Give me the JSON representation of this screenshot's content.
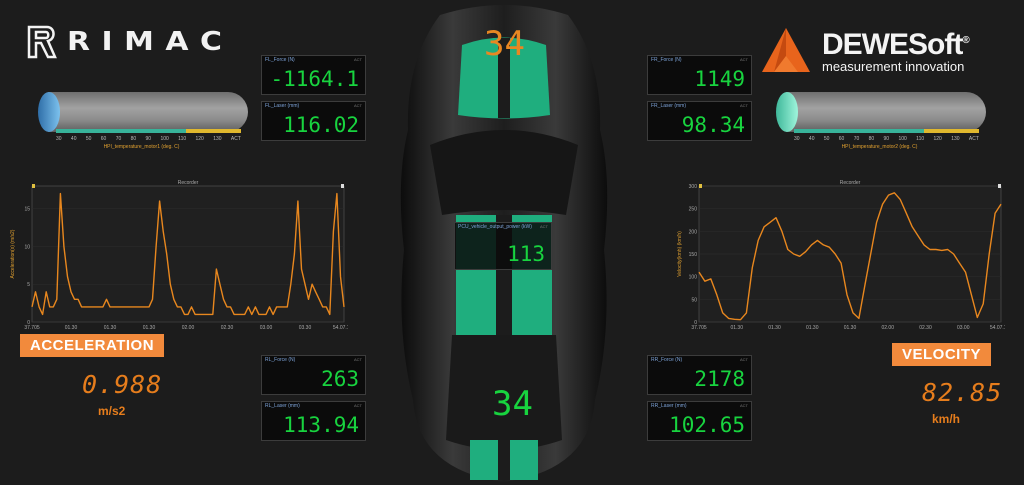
{
  "logos": {
    "rimac": "RIMAC",
    "dewesoft_name": "DEWESoft",
    "dewesoft_reg": "®",
    "dewesoft_tagline": "measurement innovation"
  },
  "gauges": {
    "left": {
      "label": "HPI_temperature_motor1 (deg. C)",
      "ticks": [
        "30",
        "40",
        "50",
        "60",
        "70",
        "80",
        "90",
        "100",
        "110",
        "120",
        "130"
      ],
      "act": "ACT",
      "fill_color": "#4aa8d8"
    },
    "right": {
      "label": "HPI_temperature_motor2 (deg. C)",
      "ticks": [
        "30",
        "40",
        "50",
        "60",
        "70",
        "80",
        "90",
        "100",
        "110",
        "120",
        "130"
      ],
      "act": "ACT",
      "fill_color": "#6fe3c2"
    }
  },
  "panels": {
    "fl_force": {
      "label": "FL_Force (N)",
      "act": "ACT",
      "value": "-1164.1"
    },
    "fl_laser": {
      "label": "FL_Laser (mm)",
      "act": "ACT",
      "value": "116.02"
    },
    "fr_force": {
      "label": "FR_Force (N)",
      "act": "ACT",
      "value": "1149"
    },
    "fr_laser": {
      "label": "FR_Laser (mm)",
      "act": "ACT",
      "value": "98.34"
    },
    "rl_force": {
      "label": "RL_Force (N)",
      "act": "ACT",
      "value": "263"
    },
    "rl_laser": {
      "label": "RL_Laser (mm)",
      "act": "ACT",
      "value": "113.94"
    },
    "rr_force": {
      "label": "RR_Force (N)",
      "act": "ACT",
      "value": "2178"
    },
    "rr_laser": {
      "label": "RR_Laser (mm)",
      "act": "ACT",
      "value": "102.65"
    },
    "pcu_power": {
      "label": "PCU_vehicle_output_power (kW)",
      "act": "ACT",
      "value": "113"
    }
  },
  "car": {
    "number_top": "34",
    "number_bottom": "34"
  },
  "acceleration": {
    "badge": "ACCELERATION",
    "value": "0.988",
    "unit": "m/s2"
  },
  "velocity": {
    "badge": "VELOCITY",
    "value": "82.85",
    "unit": "km/h"
  },
  "chart_data": [
    {
      "type": "line",
      "title": "Recorder",
      "ylabel": "Acceleration(x) (m/s2)",
      "x_ticks": [
        "37.705",
        "01.30",
        "01.30",
        "01.30",
        "02.00",
        "02.30",
        "03.00",
        "03.30",
        "54.07.181"
      ],
      "y_ticks": [
        "0",
        "5",
        "10",
        "15"
      ],
      "ylim": [
        0,
        18
      ],
      "color": "#e8871e",
      "values": [
        2,
        4,
        2,
        1,
        4,
        2,
        2,
        3,
        17,
        10,
        6,
        4,
        3,
        3,
        2,
        2,
        2,
        2,
        2,
        2,
        2,
        3,
        2,
        2,
        2,
        2,
        2,
        2,
        2,
        2,
        2,
        2,
        2,
        2,
        3,
        10,
        16,
        12,
        9,
        5,
        3,
        2,
        2,
        1,
        1,
        2,
        1,
        1,
        1,
        1,
        1,
        1,
        7,
        5,
        3,
        2,
        2,
        1,
        1,
        1,
        1,
        2,
        1,
        2,
        1,
        1,
        1,
        2,
        1,
        2,
        2,
        2,
        2,
        5,
        9,
        16,
        7,
        5,
        3,
        5,
        4,
        3,
        2,
        2,
        1,
        12,
        17,
        6,
        2
      ]
    },
    {
      "type": "line",
      "title": "Recorder",
      "ylabel": "Velocity(kmh) (km/h)",
      "x_ticks": [
        "37.705",
        "01.30",
        "01.30",
        "01.30",
        "01.30",
        "02.00",
        "02.30",
        "03.00",
        "54.07.181"
      ],
      "y_ticks": [
        "0",
        "50",
        "100",
        "150",
        "200",
        "250",
        "300"
      ],
      "ylim": [
        0,
        300
      ],
      "color": "#e8871e",
      "values": [
        110,
        90,
        95,
        60,
        20,
        8,
        6,
        5,
        20,
        120,
        180,
        210,
        220,
        230,
        200,
        160,
        150,
        145,
        155,
        170,
        180,
        170,
        165,
        150,
        130,
        60,
        20,
        8,
        80,
        150,
        220,
        260,
        280,
        285,
        270,
        240,
        210,
        190,
        170,
        160,
        160,
        158,
        160,
        150,
        130,
        110,
        60,
        10,
        40,
        150,
        240,
        260
      ]
    }
  ]
}
